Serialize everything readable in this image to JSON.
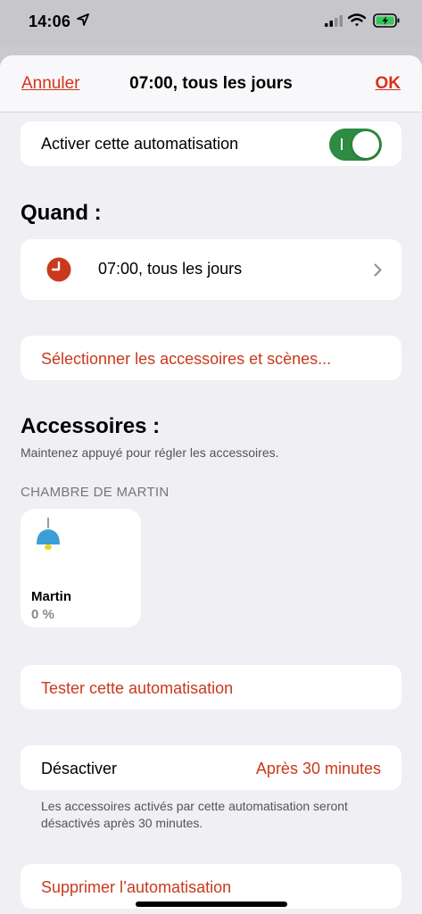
{
  "status_bar": {
    "time": "14:06",
    "icons": [
      "location-icon",
      "signal-icon",
      "wifi-icon",
      "battery-icon"
    ]
  },
  "nav": {
    "cancel_label": "Annuler",
    "title": "07:00, tous les jours",
    "ok_label": "OK"
  },
  "enable_row": {
    "label": "Activer cette automatisation",
    "toggle_on": true
  },
  "when": {
    "section_title": "Quand :",
    "trigger_label": "07:00, tous les jours",
    "icon": "clock-icon"
  },
  "select_accessories_label": "Sélectionner les accessoires et scènes...",
  "accessories": {
    "section_title": "Accessoires :",
    "hint": "Maintenez appuyé pour régler les accessoires.",
    "room_label": "CHAMBRE DE MARTIN",
    "tiles": [
      {
        "name": "Martin",
        "value": "0 %",
        "icon": "pendant-lamp-icon"
      }
    ]
  },
  "test_label": "Tester cette automatisation",
  "deactivate": {
    "label": "Désactiver",
    "value": "Après 30 minutes",
    "footnote": "Les accessoires activés par cette automatisation seront désactivés après 30 minutes."
  },
  "delete_label": "Supprimer l’automatisation",
  "colors": {
    "accent": "#c9391d",
    "toggle_on": "#2e8b41",
    "background": "#efeff4"
  }
}
